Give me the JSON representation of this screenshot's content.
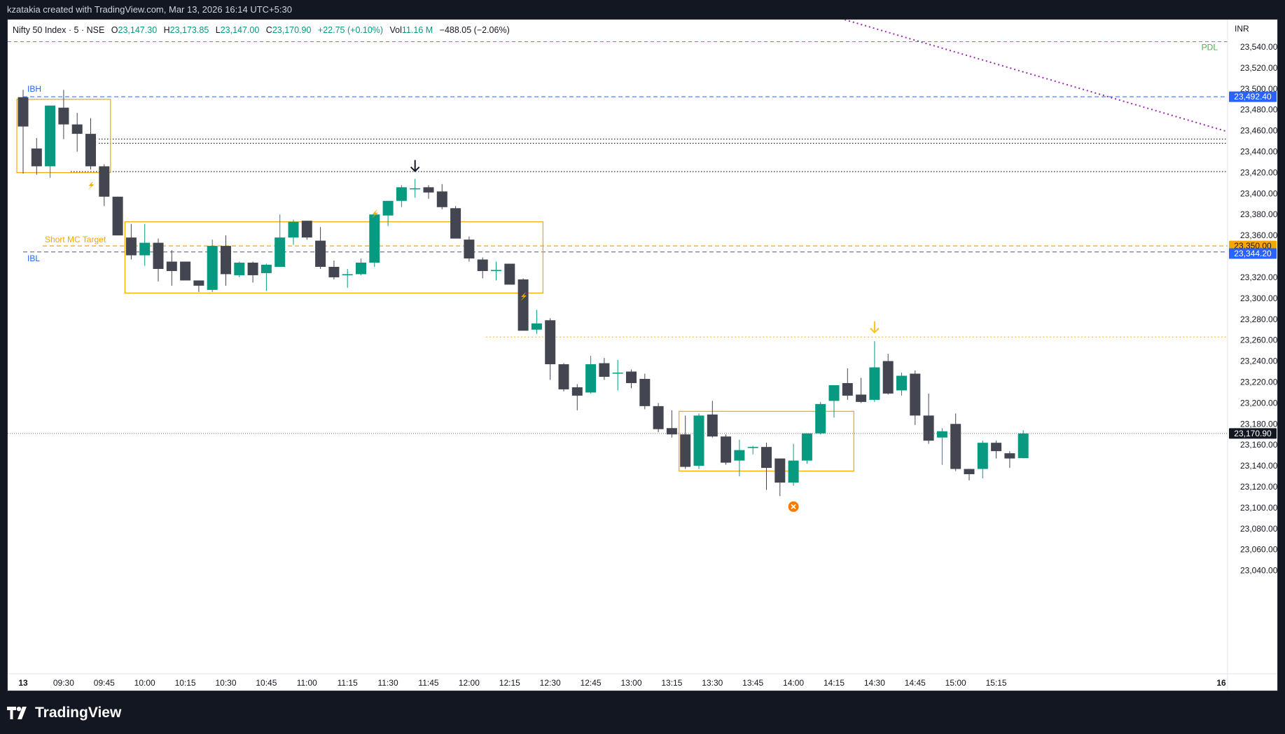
{
  "topbar": {
    "credit": "kzatakia created with TradingView.com, Mar 13, 2026 16:14 UTC+5:30"
  },
  "legend": {
    "symbol": "Nifty 50 Index · 5 · NSE",
    "o_label": "O",
    "o_value": "23,147.30",
    "h_label": "H",
    "h_value": "23,173.85",
    "l_label": "L",
    "l_value": "23,147.00",
    "c_label": "C",
    "c_value": "23,170.90",
    "change": "+22.75 (+0.10%)",
    "vol_label": "Vol",
    "vol_value": "11.16 M",
    "day_change": "−488.05 (−2.06%)"
  },
  "brand": {
    "name": "TradingView"
  },
  "colors": {
    "up": "#089981",
    "down": "#434651",
    "ib": "#2962ff",
    "target": "#f7a600",
    "pdl": "#4caf50",
    "trend": "#9c27b0",
    "box": "#f7a600"
  },
  "chart_data": {
    "type": "candlestick",
    "currency": "INR",
    "timeframe_minutes": 5,
    "candles": [
      {
        "o": 23492,
        "h": 23499,
        "l": 23419,
        "c": 23464
      },
      {
        "o": 23443,
        "h": 23453,
        "l": 23418,
        "c": 23426
      },
      {
        "o": 23426,
        "h": 23482,
        "l": 23415,
        "c": 23484
      },
      {
        "o": 23482,
        "h": 23499,
        "l": 23452,
        "c": 23466
      },
      {
        "o": 23466,
        "h": 23477,
        "l": 23440,
        "c": 23457
      },
      {
        "o": 23457,
        "h": 23472,
        "l": 23423,
        "c": 23426
      },
      {
        "o": 23426,
        "h": 23428,
        "l": 23388,
        "c": 23397
      },
      {
        "o": 23397,
        "h": 23397,
        "l": 23361,
        "c": 23360
      },
      {
        "o": 23358,
        "h": 23371,
        "l": 23337,
        "c": 23341
      },
      {
        "o": 23341,
        "h": 23371,
        "l": 23331,
        "c": 23353
      },
      {
        "o": 23353,
        "h": 23357,
        "l": 23316,
        "c": 23328
      },
      {
        "o": 23335,
        "h": 23346,
        "l": 23312,
        "c": 23326
      },
      {
        "o": 23335,
        "h": 23335,
        "l": 23318,
        "c": 23317
      },
      {
        "o": 23317,
        "h": 23317,
        "l": 23306,
        "c": 23312
      },
      {
        "o": 23308,
        "h": 23356,
        "l": 23306,
        "c": 23350
      },
      {
        "o": 23350,
        "h": 23360,
        "l": 23312,
        "c": 23323
      },
      {
        "o": 23322,
        "h": 23335,
        "l": 23320,
        "c": 23334
      },
      {
        "o": 23334,
        "h": 23335,
        "l": 23315,
        "c": 23322
      },
      {
        "o": 23324,
        "h": 23333,
        "l": 23307,
        "c": 23332
      },
      {
        "o": 23330,
        "h": 23380,
        "l": 23330,
        "c": 23358
      },
      {
        "o": 23358,
        "h": 23375,
        "l": 23351,
        "c": 23373
      },
      {
        "o": 23374,
        "h": 23374,
        "l": 23356,
        "c": 23358
      },
      {
        "o": 23355,
        "h": 23368,
        "l": 23328,
        "c": 23330
      },
      {
        "o": 23330,
        "h": 23336,
        "l": 23318,
        "c": 23320
      },
      {
        "o": 23322,
        "h": 23328,
        "l": 23310,
        "c": 23323
      },
      {
        "o": 23323,
        "h": 23338,
        "l": 23322,
        "c": 23334
      },
      {
        "o": 23334,
        "h": 23378,
        "l": 23330,
        "c": 23380
      },
      {
        "o": 23379,
        "h": 23393,
        "l": 23369,
        "c": 23393
      },
      {
        "o": 23393,
        "h": 23408,
        "l": 23387,
        "c": 23406
      },
      {
        "o": 23404,
        "h": 23414,
        "l": 23396,
        "c": 23405
      },
      {
        "o": 23406,
        "h": 23408,
        "l": 23395,
        "c": 23401
      },
      {
        "o": 23402,
        "h": 23409,
        "l": 23385,
        "c": 23387
      },
      {
        "o": 23386,
        "h": 23388,
        "l": 23359,
        "c": 23357
      },
      {
        "o": 23356,
        "h": 23359,
        "l": 23335,
        "c": 23338
      },
      {
        "o": 23337,
        "h": 23339,
        "l": 23319,
        "c": 23326
      },
      {
        "o": 23326,
        "h": 23335,
        "l": 23317,
        "c": 23327
      },
      {
        "o": 23333,
        "h": 23333,
        "l": 23317,
        "c": 23313
      },
      {
        "o": 23318,
        "h": 23319,
        "l": 23271,
        "c": 23269
      },
      {
        "o": 23270,
        "h": 23289,
        "l": 23266,
        "c": 23276
      },
      {
        "o": 23279,
        "h": 23281,
        "l": 23222,
        "c": 23237
      },
      {
        "o": 23237,
        "h": 23238,
        "l": 23211,
        "c": 23213
      },
      {
        "o": 23215,
        "h": 23218,
        "l": 23193,
        "c": 23207
      },
      {
        "o": 23210,
        "h": 23245,
        "l": 23209,
        "c": 23237
      },
      {
        "o": 23238,
        "h": 23243,
        "l": 23222,
        "c": 23225
      },
      {
        "o": 23229,
        "h": 23241,
        "l": 23212,
        "c": 23229
      },
      {
        "o": 23230,
        "h": 23232,
        "l": 23214,
        "c": 23219
      },
      {
        "o": 23223,
        "h": 23228,
        "l": 23194,
        "c": 23197
      },
      {
        "o": 23197,
        "h": 23200,
        "l": 23172,
        "c": 23175
      },
      {
        "o": 23176,
        "h": 23193,
        "l": 23167,
        "c": 23170
      },
      {
        "o": 23170,
        "h": 23188,
        "l": 23137,
        "c": 23139
      },
      {
        "o": 23140,
        "h": 23190,
        "l": 23137,
        "c": 23188
      },
      {
        "o": 23189,
        "h": 23202,
        "l": 23167,
        "c": 23168
      },
      {
        "o": 23168,
        "h": 23170,
        "l": 23141,
        "c": 23143
      },
      {
        "o": 23145,
        "h": 23165,
        "l": 23130,
        "c": 23155
      },
      {
        "o": 23157,
        "h": 23159,
        "l": 23151,
        "c": 23158
      },
      {
        "o": 23158,
        "h": 23162,
        "l": 23117,
        "c": 23138
      },
      {
        "o": 23147,
        "h": 23147,
        "l": 23111,
        "c": 23124
      },
      {
        "o": 23124,
        "h": 23161,
        "l": 23121,
        "c": 23145
      },
      {
        "o": 23145,
        "h": 23171,
        "l": 23142,
        "c": 23171
      },
      {
        "o": 23171,
        "h": 23201,
        "l": 23170,
        "c": 23199
      },
      {
        "o": 23202,
        "h": 23217,
        "l": 23186,
        "c": 23217
      },
      {
        "o": 23219,
        "h": 23233,
        "l": 23203,
        "c": 23207
      },
      {
        "o": 23208,
        "h": 23224,
        "l": 23200,
        "c": 23201
      },
      {
        "o": 23203,
        "h": 23259,
        "l": 23201,
        "c": 23234
      },
      {
        "o": 23240,
        "h": 23247,
        "l": 23208,
        "c": 23209
      },
      {
        "o": 23212,
        "h": 23229,
        "l": 23207,
        "c": 23226
      },
      {
        "o": 23228,
        "h": 23231,
        "l": 23179,
        "c": 23188
      },
      {
        "o": 23188,
        "h": 23209,
        "l": 23161,
        "c": 23164
      },
      {
        "o": 23167,
        "h": 23176,
        "l": 23141,
        "c": 23173
      },
      {
        "o": 23180,
        "h": 23190,
        "l": 23135,
        "c": 23137
      },
      {
        "o": 23137,
        "h": 23137,
        "l": 23126,
        "c": 23132
      },
      {
        "o": 23137,
        "h": 23164,
        "l": 23128,
        "c": 23162
      },
      {
        "o": 23162,
        "h": 23164,
        "l": 23147,
        "c": 23154
      },
      {
        "o": 23152,
        "h": 23154,
        "l": 23138,
        "c": 23147
      },
      {
        "o": 23147.3,
        "h": 23173.85,
        "l": 23147,
        "c": 23170.9
      }
    ],
    "y_ticks": [
      "23,540.00",
      "23,520.00",
      "23,500.00",
      "23,480.00",
      "23,460.00",
      "23,440.00",
      "23,420.00",
      "23,400.00",
      "23,380.00",
      "23,360.00",
      "23,320.00",
      "23,300.00",
      "23,280.00",
      "23,260.00",
      "23,240.00",
      "23,220.00",
      "23,200.00",
      "23,180.00",
      "23,160.00",
      "23,140.00",
      "23,120.00",
      "23,100.00",
      "23,080.00",
      "23,060.00",
      "23,040.00"
    ],
    "x_ticks": [
      "13",
      "09:30",
      "09:45",
      "10:00",
      "10:15",
      "10:30",
      "10:45",
      "11:00",
      "11:15",
      "11:30",
      "11:45",
      "12:00",
      "12:15",
      "12:30",
      "12:45",
      "13:00",
      "13:15",
      "13:30",
      "13:45",
      "14:00",
      "14:15",
      "14:30",
      "14:45",
      "15:00",
      "15:15",
      "16"
    ],
    "levels": [
      {
        "name": "IBH",
        "price": 23492.4,
        "label": "IBH",
        "tag": "23,492.40"
      },
      {
        "name": "IBL",
        "price": 23344.2,
        "label": "IBL",
        "tag": "23,344.20"
      },
      {
        "name": "short-mc-target",
        "price": 23350,
        "label": "Short MC Target",
        "tag": "23,350.00"
      },
      {
        "name": "pdl",
        "price": 23545,
        "label": "PDL"
      },
      {
        "name": "last-price",
        "price": 23170.9,
        "tag": "23,170.90"
      }
    ],
    "dotted_levels": [
      23452,
      23448,
      23421
    ],
    "yellow_level": 23263,
    "boxes": [
      {
        "from": 0,
        "to": 6,
        "top": 23490,
        "bottom": 23420
      },
      {
        "from": 8,
        "to": 38,
        "top": 23373,
        "bottom": 23305
      },
      {
        "from": 49,
        "to": 61,
        "top": 23192,
        "bottom": 23135
      }
    ],
    "ylim": [
      23030,
      23560
    ]
  }
}
